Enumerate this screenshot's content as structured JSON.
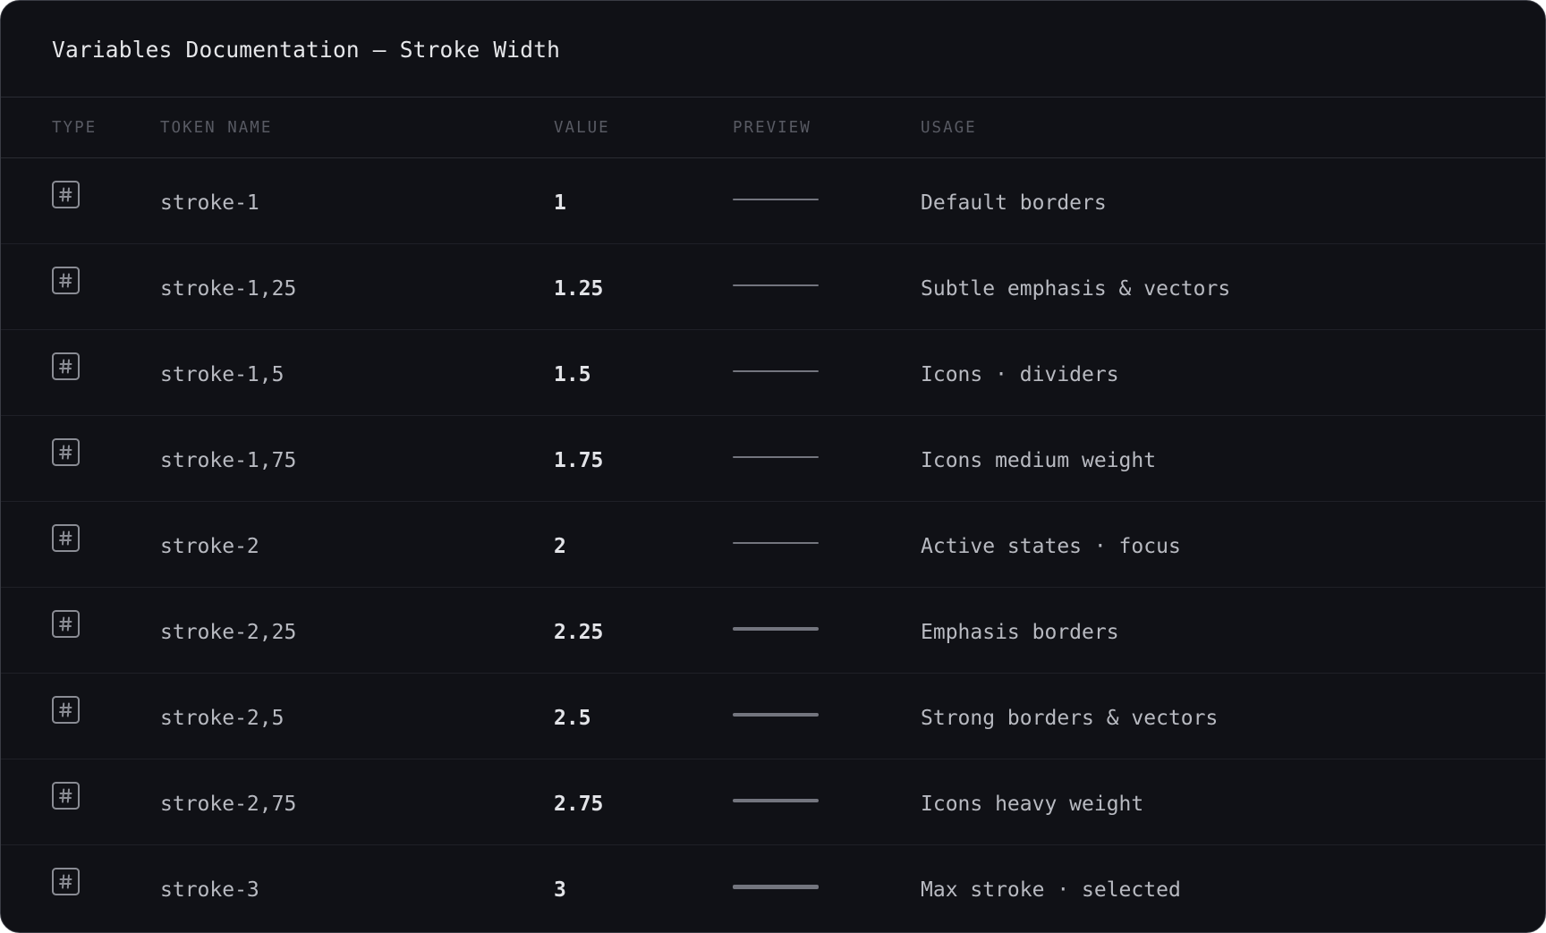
{
  "title": "Variables Documentation — Stroke Width",
  "columns": {
    "type": "TYPE",
    "token_name": "TOKEN NAME",
    "value": "VALUE",
    "preview": "PREVIEW",
    "usage": "USAGE"
  },
  "type_icon": "hash-number-icon",
  "colors": {
    "background": "#101116",
    "border": "#3a3c44",
    "row_divider": "#1f2027",
    "header_text": "#585a63",
    "body_text": "#b8bac1",
    "value_text": "#e2e3e7",
    "preview_line": "#73757e"
  },
  "rows": [
    {
      "name": "stroke-1",
      "value": "1",
      "usage": "Default borders",
      "stroke": 1
    },
    {
      "name": "stroke-1,25",
      "value": "1.25",
      "usage": "Subtle emphasis & vectors",
      "stroke": 1.25
    },
    {
      "name": "stroke-1,5",
      "value": "1.5",
      "usage": "Icons · dividers",
      "stroke": 1.5
    },
    {
      "name": "stroke-1,75",
      "value": "1.75",
      "usage": "Icons medium weight",
      "stroke": 1.75
    },
    {
      "name": "stroke-2",
      "value": "2",
      "usage": "Active states · focus",
      "stroke": 2
    },
    {
      "name": "stroke-2,25",
      "value": "2.25",
      "usage": "Emphasis borders",
      "stroke": 2.25
    },
    {
      "name": "stroke-2,5",
      "value": "2.5",
      "usage": "Strong borders & vectors",
      "stroke": 2.5
    },
    {
      "name": "stroke-2,75",
      "value": "2.75",
      "usage": "Icons heavy weight",
      "stroke": 2.75
    },
    {
      "name": "stroke-3",
      "value": "3",
      "usage": "Max stroke · selected",
      "stroke": 3
    }
  ]
}
